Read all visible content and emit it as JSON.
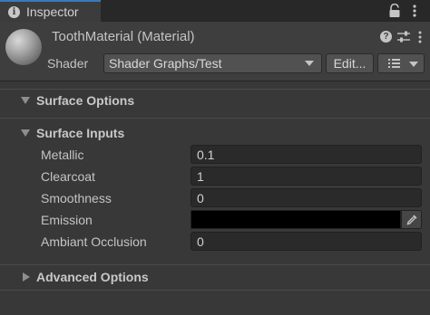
{
  "tab": {
    "icon": "info-icon",
    "icon_glyph": "i",
    "label": "Inspector"
  },
  "window_icons": [
    "lock-icon",
    "kebab-menu-icon"
  ],
  "header": {
    "title": "ToothMaterial (Material)",
    "icons": [
      "help-icon",
      "preset-icon",
      "kebab-menu-icon"
    ],
    "help_glyph": "?",
    "shader_label": "Shader",
    "shader_value": "Shader Graphs/Test",
    "edit_label": "Edit..."
  },
  "sections": {
    "surface_options": {
      "label": "Surface Options",
      "expanded": false
    },
    "surface_inputs": {
      "label": "Surface Inputs",
      "expanded": true
    },
    "advanced_options": {
      "label": "Advanced Options",
      "expanded": false
    }
  },
  "properties": {
    "metallic": {
      "label": "Metallic",
      "value": "0.1"
    },
    "clearcoat": {
      "label": "Clearcoat",
      "value": "1"
    },
    "smoothness": {
      "label": "Smoothness",
      "value": "0"
    },
    "emission": {
      "label": "Emission",
      "color": "#000000"
    },
    "ambiant_occlusion": {
      "label": "Ambiant Occlusion",
      "value": "0"
    }
  },
  "colors": {
    "background": "#383838",
    "tab_accent": "#3a79bb",
    "field_bg": "#2a2a2a",
    "button_bg": "#515151"
  }
}
